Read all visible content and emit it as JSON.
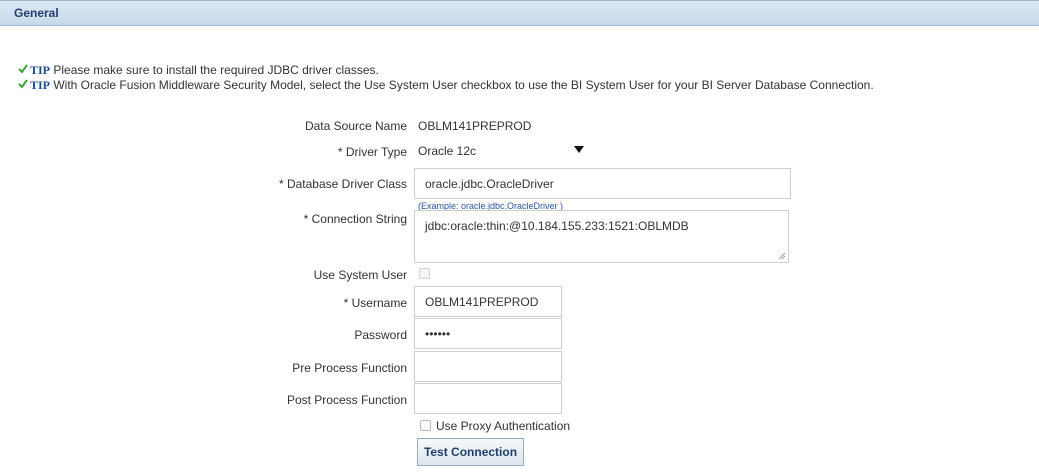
{
  "section": {
    "title": "General"
  },
  "tips": [
    {
      "label": "TIP",
      "text": " Please make sure to install the required JDBC driver classes."
    },
    {
      "label": "TIP",
      "text": " With Oracle Fusion Middleware Security Model, select the Use System User checkbox to use the BI System User for your BI Server Database Connection."
    }
  ],
  "form": {
    "data_source_name": {
      "label": "Data Source Name",
      "value": "OBLM141PREPROD"
    },
    "driver_type": {
      "label": "* Driver Type",
      "value": "Oracle 12c"
    },
    "database_driver_class": {
      "label": "* Database Driver Class",
      "value": "oracle.jdbc.OracleDriver",
      "hint": "(Example: oracle.jdbc.OracleDriver )"
    },
    "connection_string": {
      "label": "* Connection String",
      "value": "jdbc:oracle:thin:@10.184.155.233:1521:OBLMDB"
    },
    "use_system_user": {
      "label": "Use System User",
      "checked": false,
      "disabled": true
    },
    "username": {
      "label": "* Username",
      "value": "OBLM141PREPROD"
    },
    "password": {
      "label": "Password",
      "value": "••••••"
    },
    "pre_process_function": {
      "label": "Pre Process Function",
      "value": ""
    },
    "post_process_function": {
      "label": "Post Process Function",
      "value": ""
    },
    "use_proxy_authentication": {
      "label": "Use Proxy Authentication",
      "checked": false
    },
    "test_connection": {
      "label": "Test Connection"
    }
  },
  "colors": {
    "header_bg": "#c6d9ec",
    "tip_label": "#1c4a8a",
    "tip_check": "#3aa33a",
    "hint": "#2a55a0"
  }
}
